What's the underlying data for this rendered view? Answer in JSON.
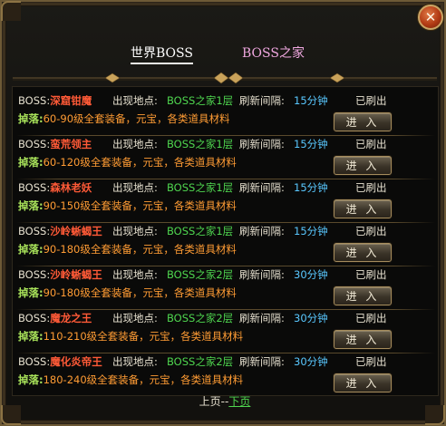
{
  "tabs": {
    "world": "世界BOSS",
    "home": "BOSS之家"
  },
  "close_icon": "close-x-icon",
  "labels": {
    "boss": "BOSS:",
    "location": "出现地点:",
    "interval": "刷新间隔:",
    "drop": "掉落:",
    "enter": "进 入"
  },
  "rows": [
    {
      "name": "深窟钳魔",
      "location": "BOSS之家1层",
      "interval": "15分钟",
      "status": "已刷出",
      "drop": "60-90级全套装备，元宝，各类道具材料"
    },
    {
      "name": "蛮荒领主",
      "location": "BOSS之家1层",
      "interval": "15分钟",
      "status": "已刷出",
      "drop": "60-120级全套装备，元宝，各类道具材料"
    },
    {
      "name": "森林老妖",
      "location": "BOSS之家1层",
      "interval": "15分钟",
      "status": "已刷出",
      "drop": "90-150级全套装备，元宝，各类道具材料"
    },
    {
      "name": "沙岭蜥蝎王",
      "location": "BOSS之家1层",
      "interval": "15分钟",
      "status": "已刷出",
      "drop": "90-180级全套装备，元宝，各类道具材料"
    },
    {
      "name": "沙岭蜥蝎王",
      "location": "BOSS之家2层",
      "interval": "30分钟",
      "status": "已刷出",
      "drop": "90-180级全套装备，元宝，各类道具材料"
    },
    {
      "name": "魔龙之王",
      "location": "BOSS之家2层",
      "interval": "30分钟",
      "status": "已刷出",
      "drop": "110-210级全套装备，元宝，各类道具材料"
    },
    {
      "name": "魔化炎帝王",
      "location": "BOSS之家2层",
      "interval": "30分钟",
      "status": "已刷出",
      "drop": "180-240级全套装备，元宝，各类道具材料"
    }
  ],
  "pager": {
    "prev": "上页",
    "dash": "--",
    "next": "下页"
  }
}
